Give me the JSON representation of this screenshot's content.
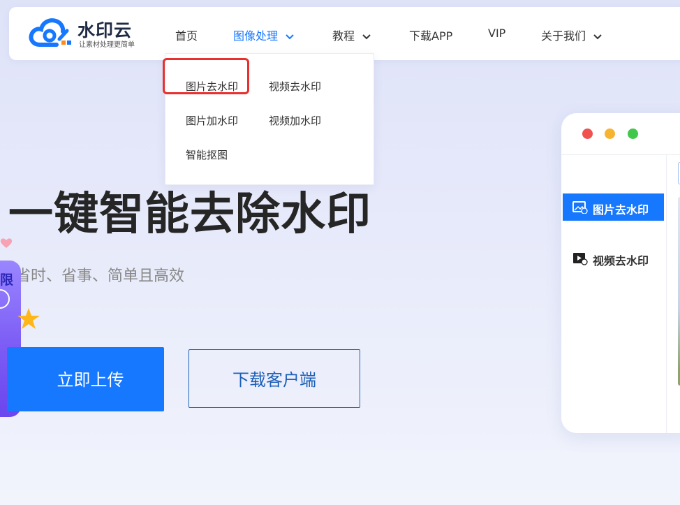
{
  "brand": {
    "name": "水印云",
    "slogan": "让素材处理更简单"
  },
  "nav": {
    "items": [
      {
        "label": "首页"
      },
      {
        "label": "图像处理"
      },
      {
        "label": "教程"
      },
      {
        "label": "下载APP"
      },
      {
        "label": "VIP"
      },
      {
        "label": "关于我们"
      }
    ]
  },
  "dropdown": {
    "items": [
      {
        "label": "图片去水印"
      },
      {
        "label": "视频去水印"
      },
      {
        "label": "图片加水印"
      },
      {
        "label": "视频加水印"
      },
      {
        "label": "智能抠图"
      }
    ]
  },
  "hero": {
    "title": "一键智能去除水印",
    "subtitle": "省时、省事、简单且高效"
  },
  "promo": {
    "text": "限"
  },
  "buttons": {
    "upload": "立即上传",
    "download": "下载客户端"
  },
  "app_preview": {
    "sidebar": [
      {
        "label": "图片去水印",
        "active": true
      },
      {
        "label": "视频去水印",
        "active": false
      }
    ]
  },
  "colors": {
    "accent": "#1677ff",
    "highlight_box": "#e8302e",
    "window_dots": [
      "#f0524f",
      "#f7b431",
      "#41c74a"
    ]
  }
}
